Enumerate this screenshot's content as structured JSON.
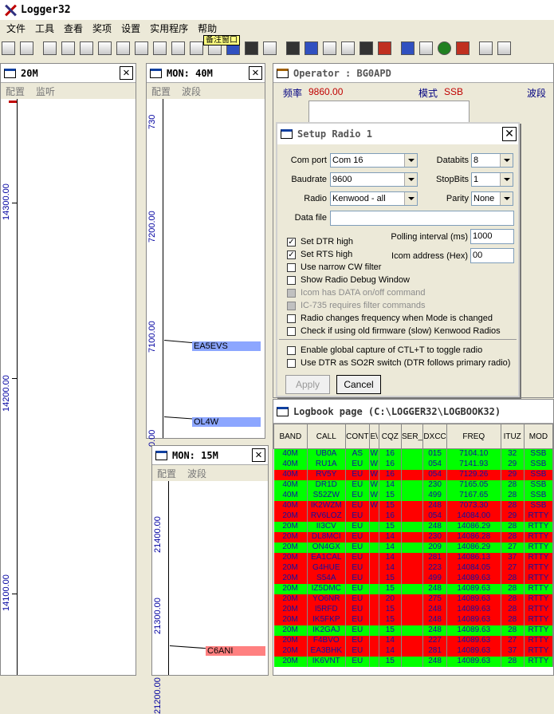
{
  "app": {
    "title": "Logger32"
  },
  "menu": [
    "文件",
    "工具",
    "查看",
    "奖项",
    "设置",
    "实用程序",
    "帮助"
  ],
  "toolbar_tooltip": "备注窗口",
  "bandmaps": [
    {
      "title": "20M",
      "menu": [
        "配置",
        "监听"
      ],
      "freqs": [
        "14300.00",
        "14200.00",
        "14100.00"
      ],
      "spots": []
    },
    {
      "title": "MON: 40M",
      "menu": [
        "配置",
        "波段"
      ],
      "freqs": [
        "730",
        "7200.00",
        "7100.00",
        "0.00"
      ],
      "spots": [
        "EA5EVS",
        "OL4W"
      ]
    },
    {
      "title": "MON: 15M",
      "menu": [
        "配置",
        "波段"
      ],
      "freqs": [
        "21400.00",
        "21300.00",
        "21200.00"
      ],
      "spots": [
        "C6ANI"
      ]
    }
  ],
  "operator": {
    "title": "Operator : BG0APD",
    "freq_label": "频率",
    "freq_value": "9860.00",
    "mode_label": "模式",
    "mode_value": "SSB",
    "band_label": "波段"
  },
  "setup": {
    "title": "Setup Radio 1",
    "comport_label": "Com port",
    "comport_value": "Com 16",
    "databits_label": "Databits",
    "databits_value": "8",
    "baud_label": "Baudrate",
    "baud_value": "9600",
    "stopbits_label": "StopBits",
    "stopbits_value": "1",
    "radio_label": "Radio",
    "radio_value": "Kenwood - all",
    "parity_label": "Parity",
    "parity_value": "None",
    "datafile_label": "Data file",
    "datafile_value": "",
    "polling_label": "Polling interval (ms)",
    "polling_value": "1000",
    "icom_label": "Icom address (Hex)",
    "icom_value": "00",
    "checks": [
      {
        "label": "Set DTR high",
        "checked": true,
        "disabled": false
      },
      {
        "label": "Set RTS high",
        "checked": true,
        "disabled": false
      },
      {
        "label": "Use narrow CW filter",
        "checked": false,
        "disabled": false
      },
      {
        "label": "Show Radio Debug Window",
        "checked": false,
        "disabled": false
      },
      {
        "label": "Icom has DATA on/off command",
        "checked": false,
        "disabled": true
      },
      {
        "label": "IC-735 requires filter commands",
        "checked": false,
        "disabled": true
      },
      {
        "label": "Radio changes frequency when Mode is changed",
        "checked": false,
        "disabled": false
      },
      {
        "label": "Check if using old firmware (slow) Kenwood Radios",
        "checked": false,
        "disabled": false
      },
      {
        "label": "Enable global capture of CTL+T to toggle radio",
        "checked": false,
        "disabled": false
      },
      {
        "label": "Use DTR as SO2R switch (DTR follows primary radio)",
        "checked": false,
        "disabled": false
      }
    ],
    "apply_label": "Apply",
    "cancel_label": "Cancel"
  },
  "logbook": {
    "title": "Logbook page (C:\\LOGGER32\\LOGBOOK32)",
    "columns": [
      "BAND",
      "CALL",
      "CONT",
      "E\\",
      "CQZ",
      "SER_",
      "DXCC",
      "FREQ",
      "ITUZ",
      "MOD"
    ],
    "rows": [
      {
        "color": "green",
        "cells": [
          "40M",
          "UB0A",
          "AS",
          "W",
          "16",
          "",
          "015",
          "7104.10",
          "32",
          "SSB"
        ]
      },
      {
        "color": "green",
        "cells": [
          "40M",
          "RU1A",
          "EU",
          "W",
          "16",
          "",
          "054",
          "7141.93",
          "29",
          "SSB"
        ]
      },
      {
        "color": "red",
        "cells": [
          "40M",
          "RV5Y",
          "EU",
          "W",
          "16",
          "",
          "054",
          "7129.26",
          "29",
          "SSB"
        ]
      },
      {
        "color": "green",
        "cells": [
          "40M",
          "DR1D",
          "EU",
          "W",
          "14",
          "",
          "230",
          "7165.05",
          "28",
          "SSB"
        ]
      },
      {
        "color": "green",
        "cells": [
          "40M",
          "S52ZW",
          "EU",
          "W",
          "15",
          "",
          "499",
          "7167.65",
          "28",
          "SSB"
        ]
      },
      {
        "color": "red",
        "cells": [
          "40M",
          "IK2WZM",
          "EU",
          "W",
          "15",
          "",
          "248",
          "7073.30",
          "28",
          "SSB"
        ]
      },
      {
        "color": "red",
        "cells": [
          "20M",
          "RV6LOZ",
          "EU",
          "",
          "16",
          "",
          "054",
          "14084.00",
          "29",
          "RTTY"
        ]
      },
      {
        "color": "green",
        "cells": [
          "20M",
          "II3CV",
          "EU",
          "",
          "15",
          "",
          "248",
          "14086.29",
          "28",
          "RTTY"
        ]
      },
      {
        "color": "red",
        "cells": [
          "20M",
          "DL8MCI",
          "EU",
          "",
          "14",
          "",
          "230",
          "14086.28",
          "28",
          "RTTY"
        ]
      },
      {
        "color": "green",
        "cells": [
          "20M",
          "ON4GX",
          "EU",
          "",
          "14",
          "",
          "209",
          "14086.29",
          "27",
          "RTTY"
        ]
      },
      {
        "color": "red",
        "cells": [
          "20M",
          "EA1CAL",
          "EU",
          "",
          "14",
          "",
          "281",
          "14086.13",
          "37",
          "RTTY"
        ]
      },
      {
        "color": "red",
        "cells": [
          "20M",
          "G4HUE",
          "EU",
          "",
          "14",
          "",
          "223",
          "14084.05",
          "27",
          "RTTY"
        ]
      },
      {
        "color": "red",
        "cells": [
          "20M",
          "S54A",
          "EU",
          "",
          "15",
          "",
          "499",
          "14089.63",
          "28",
          "RTTY"
        ]
      },
      {
        "color": "green",
        "cells": [
          "20M",
          "IZ5DMC",
          "EU",
          "",
          "15",
          "",
          "248",
          "14089.63",
          "28",
          "RTTY"
        ]
      },
      {
        "color": "red",
        "cells": [
          "20M",
          "YO6NR",
          "EU",
          "",
          "20",
          "",
          "275",
          "14089.63",
          "28",
          "RTTY"
        ]
      },
      {
        "color": "red",
        "cells": [
          "20M",
          "I5RFD",
          "EU",
          "",
          "15",
          "",
          "248",
          "14089.63",
          "28",
          "RTTY"
        ]
      },
      {
        "color": "red",
        "cells": [
          "20M",
          "IK5FKP",
          "EU",
          "",
          "15",
          "",
          "248",
          "14089.63",
          "28",
          "RTTY"
        ]
      },
      {
        "color": "green",
        "cells": [
          "20M",
          "IK2GAJ",
          "EU",
          "",
          "15",
          "",
          "248",
          "14089.63",
          "28",
          "RTTY"
        ]
      },
      {
        "color": "red",
        "cells": [
          "20M",
          "F4BVO",
          "EU",
          "",
          "14",
          "",
          "227",
          "14089.63",
          "27",
          "RTTY"
        ]
      },
      {
        "color": "red",
        "cells": [
          "20M",
          "EA3BHK",
          "EU",
          "",
          "14",
          "",
          "281",
          "14089.63",
          "37",
          "RTTY"
        ]
      },
      {
        "color": "green",
        "cells": [
          "20M",
          "IK6VNT",
          "EU",
          "",
          "15",
          "",
          "248",
          "14089.63",
          "28",
          "RTTY"
        ]
      }
    ]
  },
  "colors": {
    "spot_blue": "#8ca6ff",
    "spot_red": "#ff8080",
    "row_green": "#00ff00",
    "row_red": "#ff0000"
  }
}
